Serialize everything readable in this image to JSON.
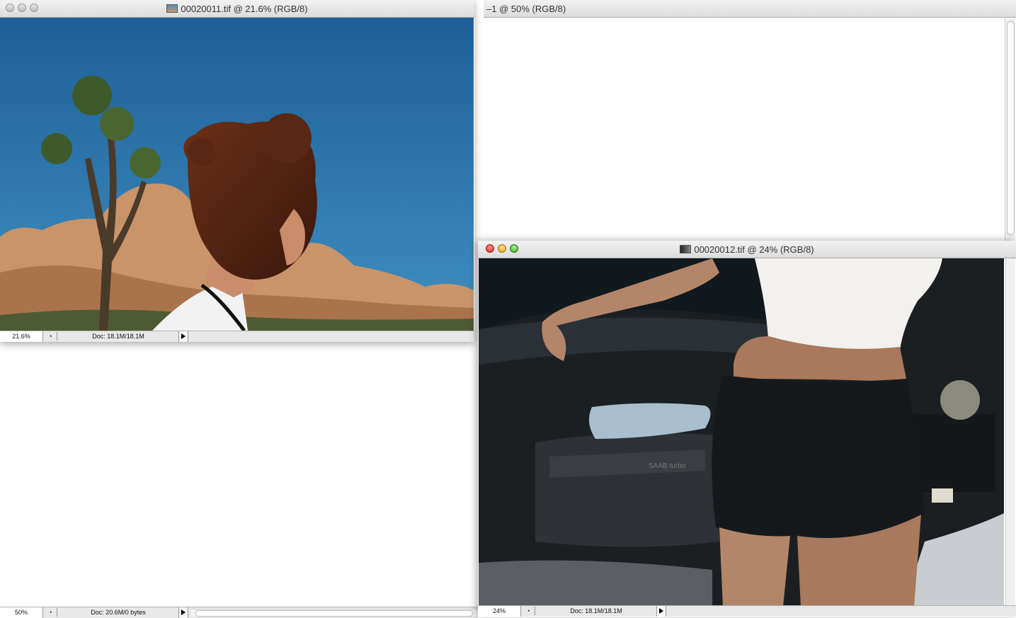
{
  "window_back": {
    "title": "–1 @ 50% (RGB/8)",
    "zoom": "50%",
    "doc_info": "Doc: 20.6M/0 bytes"
  },
  "window_a": {
    "title": "00020011.tif @ 21.6% (RGB/8)",
    "zoom": "21.6%",
    "doc_info": "Doc: 18.1M/18.1M"
  },
  "window_b": {
    "title": "00020012.tif @ 24% (RGB/8)",
    "zoom": "24%",
    "doc_info": "Doc: 18.1M/18.1M",
    "bottle_label": "SAAB turbo"
  },
  "colors": {
    "sky": "#2f7fb3",
    "rock": "#c9946a",
    "engine": "#1c1f22"
  }
}
